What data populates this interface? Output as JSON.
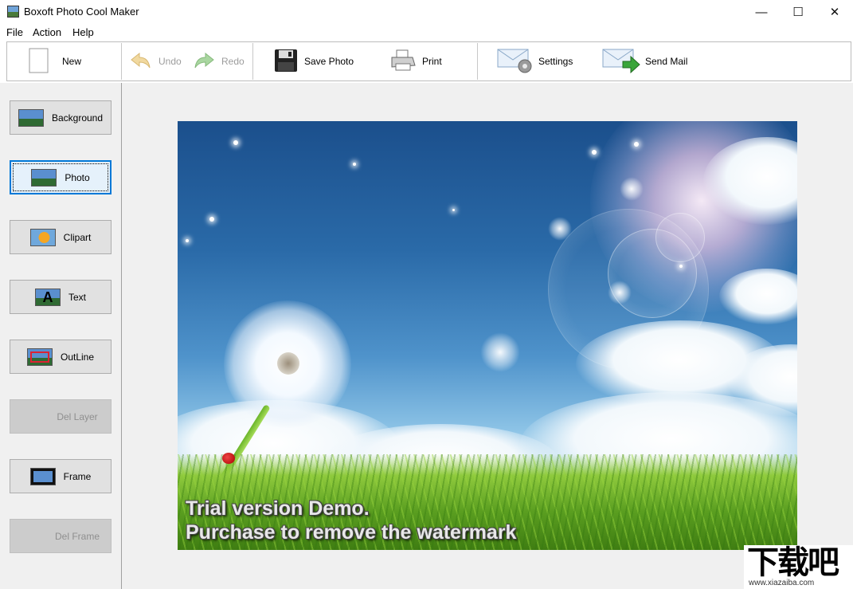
{
  "window": {
    "title": "Boxoft Photo Cool Maker",
    "minimize": "—",
    "maximize": "☐",
    "close": "✕"
  },
  "menu": {
    "items": [
      "File",
      "Action",
      "Help"
    ]
  },
  "toolbar": {
    "new_label": "New",
    "undo_label": "Undo",
    "redo_label": "Redo",
    "save_label": "Save Photo",
    "print_label": "Print",
    "settings_label": "Settings",
    "sendmail_label": "Send Mail",
    "disabled_color": "#9c9c9c"
  },
  "sidebar": {
    "items": [
      {
        "label": "Background",
        "icon": "landscape-icon",
        "enabled": true,
        "selected": false
      },
      {
        "label": "Photo",
        "icon": "photo-icon",
        "enabled": true,
        "selected": true
      },
      {
        "label": "Clipart",
        "icon": "smiley-icon",
        "enabled": true,
        "selected": false
      },
      {
        "label": "Text",
        "icon": "text-a-icon",
        "enabled": true,
        "selected": false
      },
      {
        "label": "OutLine",
        "icon": "outline-icon",
        "enabled": true,
        "selected": false
      },
      {
        "label": "Del Layer",
        "icon": "delete-layer-icon",
        "enabled": false,
        "selected": false
      },
      {
        "label": "Frame",
        "icon": "frame-icon",
        "enabled": true,
        "selected": false
      },
      {
        "label": "Del Frame",
        "icon": "delete-frame-icon",
        "enabled": false,
        "selected": false
      }
    ]
  },
  "canvas": {
    "watermark_line1": "Trial version Demo.",
    "watermark_line2": "Purchase to remove the watermark"
  },
  "site_badge": {
    "logo": "下载吧",
    "url": "www.xiazaiba.com"
  },
  "colors": {
    "selection_border": "#0078d7",
    "panel_bg": "#f0f0f0"
  }
}
